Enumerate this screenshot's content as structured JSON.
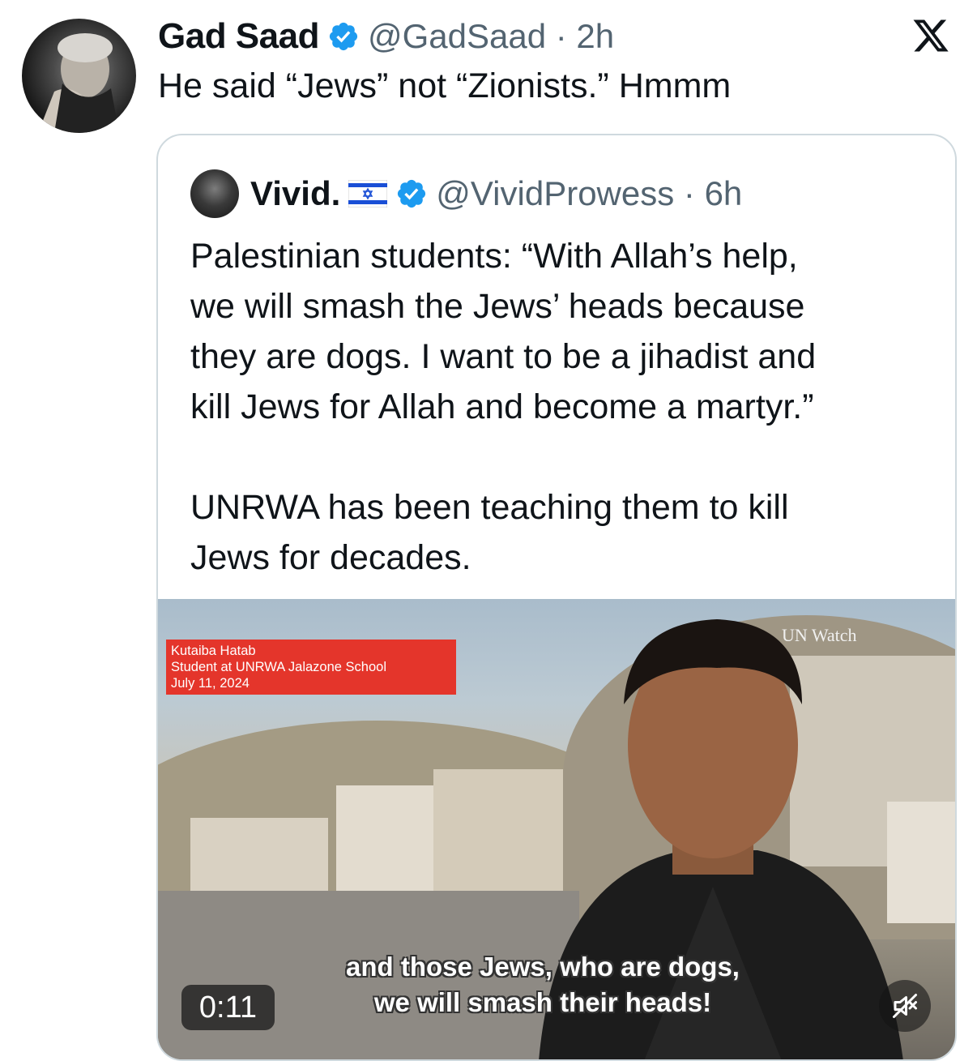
{
  "tweet": {
    "author_name": "Gad Saad",
    "handle_time": "@GadSaad · 2h",
    "text": "He said “Jews” not “Zionists.” Hmmm"
  },
  "quoted": {
    "author_name": "Vivid.",
    "handle_time": "@VividProwess · 6h",
    "lines": [
      "Palestinian students: “With Allah’s help,",
      "we will smash the Jews’ heads because",
      "they are dogs. I want to be a jihadist and",
      "kill Jews for Allah and become a martyr.”"
    ],
    "lines2": [
      "UNRWA has been teaching them to kill",
      "Jews for decades."
    ]
  },
  "video": {
    "lower_third": [
      "Kutaiba Hatab",
      "Student at UNRWA Jalazone School",
      "July 11, 2024"
    ],
    "watermark": "UN Watch",
    "subtitles": [
      "and those Jews, who are dogs,",
      "we will smash their heads!"
    ],
    "duration": "0:11"
  },
  "icons": {
    "verified": "verified-badge-icon",
    "flag": "israel-flag-icon",
    "x": "x-logo-icon",
    "mute": "muted-speaker-icon"
  },
  "colors": {
    "verified_blue": "#1d9bf0",
    "secondary_text": "#536471",
    "lower_third_red": "#e4352b"
  }
}
